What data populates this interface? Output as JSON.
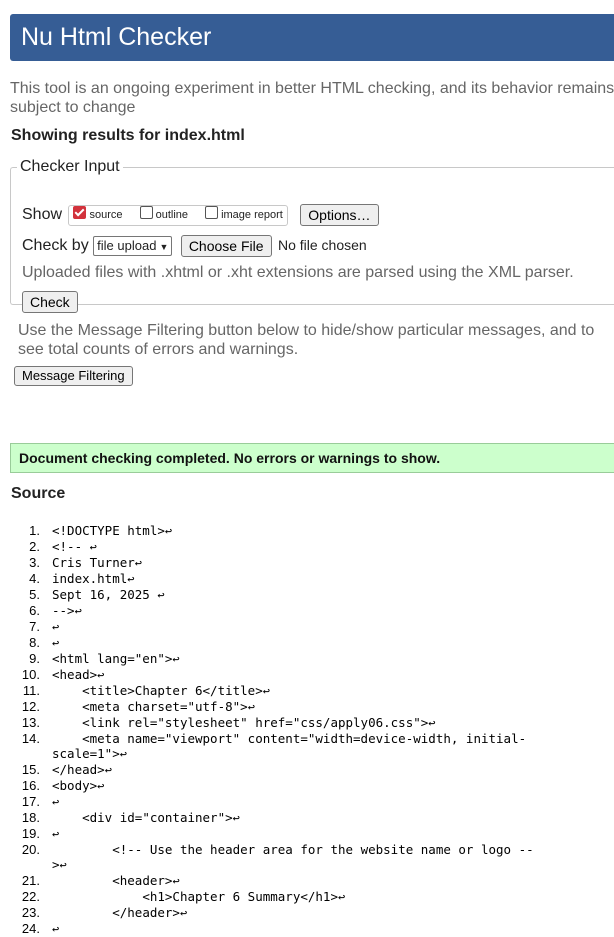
{
  "app_title": "Nu Html Checker",
  "intro": "This tool is an ongoing experiment in better HTML checking, and its behavior remains subject to change",
  "results_for": "Showing results for index.html",
  "checker_input": {
    "legend": "Checker Input",
    "show_label": "Show",
    "show_options": [
      {
        "label": "source",
        "checked": true
      },
      {
        "label": "outline",
        "checked": false
      },
      {
        "label": "image report",
        "checked": false
      }
    ],
    "options_button": "Options…",
    "check_by_label": "Check by",
    "check_by_value": "file upload",
    "choose_file_button": "Choose File",
    "file_status": "No file chosen",
    "note": "Uploaded files with .xhtml or .xht extensions are parsed using the XML parser.",
    "check_button": "Check"
  },
  "filter_text": "Use the Message Filtering button below to hide/show particular messages, and to see total counts of errors and warnings.",
  "filter_button": "Message Filtering",
  "success_message": "Document checking completed. No errors or warnings to show.",
  "source_heading": "Source",
  "source_lines": [
    {
      "n": "1.",
      "code": "<!DOCTYPE html>"
    },
    {
      "n": "2.",
      "code": "<!-- "
    },
    {
      "n": "3.",
      "code": "Cris Turner"
    },
    {
      "n": "4.",
      "code": "index.html"
    },
    {
      "n": "5.",
      "code": "Sept 16, 2025 "
    },
    {
      "n": "6.",
      "code": "-->"
    },
    {
      "n": "7.",
      "code": ""
    },
    {
      "n": "8.",
      "code": ""
    },
    {
      "n": "9.",
      "code": "<html lang=\"en\">"
    },
    {
      "n": "10.",
      "code": "<head>"
    },
    {
      "n": "11.",
      "code": "    <title>Chapter 6</title>"
    },
    {
      "n": "12.",
      "code": "    <meta charset=\"utf-8\">"
    },
    {
      "n": "13.",
      "code": "    <link rel=\"stylesheet\" href=\"css/apply06.css\">"
    },
    {
      "n": "14.",
      "code": "    <meta name=\"viewport\" content=\"width=device-width, initial-scale=1\">"
    },
    {
      "n": "15.",
      "code": "</head>"
    },
    {
      "n": "16.",
      "code": "<body>"
    },
    {
      "n": "17.",
      "code": ""
    },
    {
      "n": "18.",
      "code": "    <div id=\"container\">"
    },
    {
      "n": "19.",
      "code": ""
    },
    {
      "n": "20.",
      "code": "        <!-- Use the header area for the website name or logo -->"
    },
    {
      "n": "21.",
      "code": "        <header>"
    },
    {
      "n": "22.",
      "code": "            <h1>Chapter 6 Summary</h1>"
    },
    {
      "n": "23.",
      "code": "        </header>"
    },
    {
      "n": "24.",
      "code": ""
    }
  ],
  "return_glyph": "↩"
}
